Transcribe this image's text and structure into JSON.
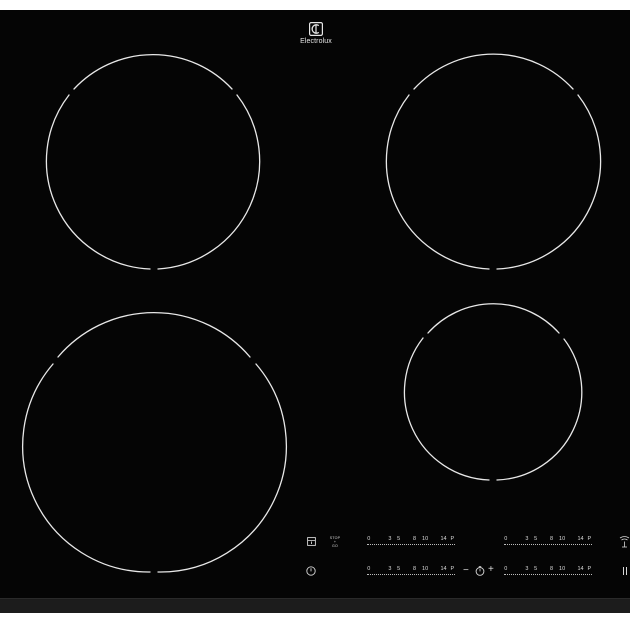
{
  "brand": {
    "name": "Electrolux",
    "logo_icon": "electrolux-logo-icon"
  },
  "colors": {
    "surface": "#050505",
    "zone_outline": "#e8e8e8",
    "text": "#dcdcdc"
  },
  "zones": [
    {
      "name": "cooking-zone-rear-left"
    },
    {
      "name": "cooking-zone-rear-right"
    },
    {
      "name": "cooking-zone-front-left"
    },
    {
      "name": "cooking-zone-front-right"
    }
  ],
  "controls": {
    "stop_go": {
      "label": "STOP + GO",
      "line1": "STOP",
      "line2": "+",
      "line3": "GO"
    },
    "lock_icon": "lock-icon",
    "power_icon": "power-icon",
    "timer": {
      "minus": "−",
      "plus": "+",
      "icon": "timer-icon"
    },
    "hob2hood_icon": "hob2hood-icon",
    "power_scale_labels": [
      "0",
      "3",
      "5",
      "8",
      "10",
      "14",
      "P"
    ]
  }
}
